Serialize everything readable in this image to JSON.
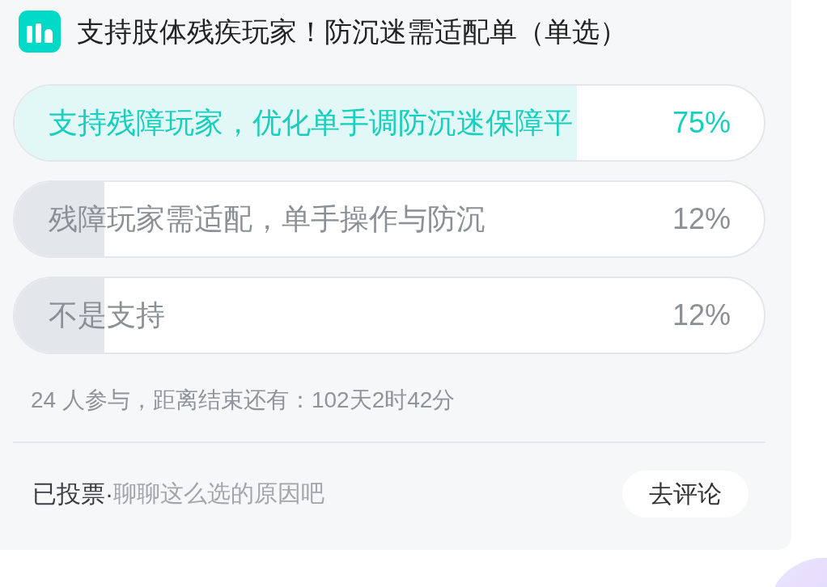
{
  "poll": {
    "title": "支持肢体残疾玩家！防沉迷需适配单（单选）",
    "options": [
      {
        "text": "支持残障玩家，优化单手调防沉迷保障平",
        "percent": "75%",
        "level": 0.75,
        "selected": true
      },
      {
        "text": "残障玩家需适配，单手操作与防沉",
        "percent": "12%",
        "level": 0.12,
        "selected": false
      },
      {
        "text": "不是支持",
        "percent": "12%",
        "level": 0.12,
        "selected": false
      }
    ],
    "summary": "24 人参与，距离结束还有：102天2时42分",
    "footer": {
      "status": "已投票·",
      "prompt": "聊聊这么选的原因吧",
      "button": "去评论"
    }
  }
}
